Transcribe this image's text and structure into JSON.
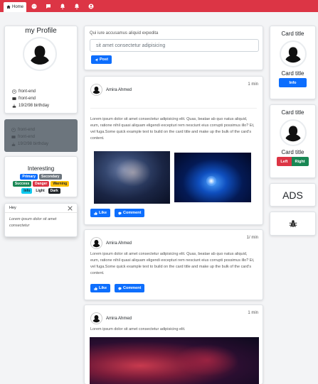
{
  "nav": {
    "home_label": "Home",
    "icons": [
      "home-icon",
      "game-icon",
      "chat-icon",
      "bell-icon",
      "notification-icon",
      "user-circle-icon"
    ]
  },
  "profile": {
    "title": "my Profile",
    "info": [
      {
        "icon": "user-icon",
        "text": "front-end"
      },
      {
        "icon": "id-card-icon",
        "text": "front-end"
      },
      {
        "icon": "cake-icon",
        "text": "19/2/98 birthday"
      }
    ]
  },
  "grey_card": {
    "info": [
      {
        "icon": "user-icon",
        "text": "front-end"
      },
      {
        "icon": "id-card-icon",
        "text": "front-end"
      },
      {
        "icon": "cake-icon",
        "text": "19/2/98 birthday"
      }
    ]
  },
  "interesting": {
    "title": "Interesting",
    "badges": [
      {
        "label": "Primary",
        "color": "#0d6efd",
        "text": "#ffffff"
      },
      {
        "label": "Secondary",
        "color": "#6c757d",
        "text": "#ffffff"
      },
      {
        "label": "Success",
        "color": "#198754",
        "text": "#ffffff"
      },
      {
        "label": "Danger",
        "color": "#dc3545",
        "text": "#ffffff"
      },
      {
        "label": "Warning",
        "color": "#ffc107",
        "text": "#212529"
      },
      {
        "label": "Info",
        "color": "#0dcaf0",
        "text": "#212529"
      },
      {
        "label": "Light",
        "color": "#f8f9fa",
        "text": "#212529"
      },
      {
        "label": "Dark",
        "color": "#212529",
        "text": "#ffffff"
      }
    ]
  },
  "toast": {
    "title": "Hey",
    "body": "Lorem ipsum dolor sit amet consectetur"
  },
  "composer": {
    "label": "Qui iure accusamus aliquid expedita",
    "input_value": "sit amet consectetur adipisicing",
    "post_button": "Post"
  },
  "posts": [
    {
      "author": "Amira Ahmed",
      "time": "1 min",
      "text": "Lorem ipsum dolor sit amet consectetur adipisicing elit. Quas, beatae ab quo natus aliquid, eum, ratione nihil quasi aliquam eligendi excepturi rem nesciunt eius corrupti possimus illo? Et, vel fuga.Some quick example text to build on the card title and make up the bulk of the card's content.",
      "like": "Like",
      "comment": "Comment"
    },
    {
      "author": "Amira Ahmed",
      "time": "1/ min",
      "text": "Lorem ipsum dolor sit amet consectetur adipisicing elit. Quas, beatae ab quo natus aliquid, eum, ratione nihil quasi aliquam eligendi excepturi rem nesciunt eius corrupti possimus illo? Et, vel fuga.Some quick example text to build on the card title and make up the bulk of the card's content.",
      "like": "Like",
      "comment": "Comment"
    },
    {
      "author": "Amira Ahmed",
      "time": "1 min",
      "text": "Lorem ipsum dolor sit amet consectetur adipisicing elit."
    }
  ],
  "right_cards": [
    {
      "title": "Card title",
      "subtitle": "Card title",
      "button": "Info"
    },
    {
      "title": "Card title",
      "subtitle": "Card title",
      "left": "Left",
      "right": "Right"
    }
  ],
  "ads": {
    "label": "ADS",
    "icon": "bug-icon"
  }
}
